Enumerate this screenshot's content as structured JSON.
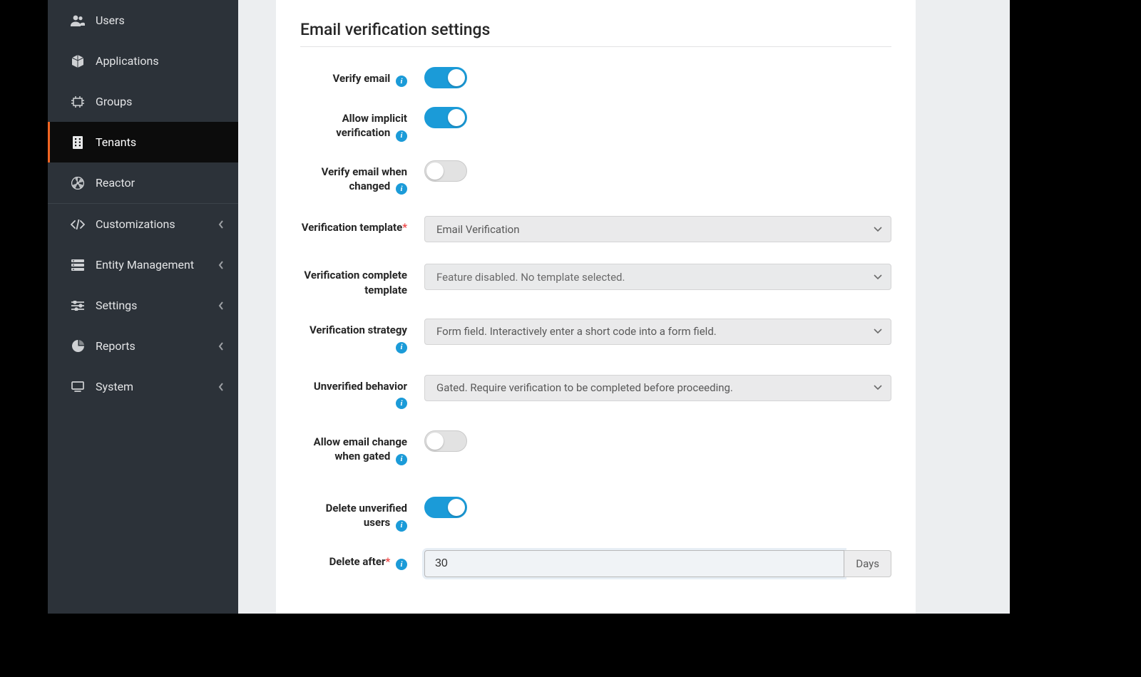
{
  "sidebar": {
    "items": [
      {
        "label": "Users"
      },
      {
        "label": "Applications"
      },
      {
        "label": "Groups"
      },
      {
        "label": "Tenants"
      },
      {
        "label": "Reactor"
      },
      {
        "label": "Customizations"
      },
      {
        "label": "Entity Management"
      },
      {
        "label": "Settings"
      },
      {
        "label": "Reports"
      },
      {
        "label": "System"
      }
    ],
    "active_index": 3
  },
  "section_title": "Email verification settings",
  "labels": {
    "verify_email": "Verify email",
    "allow_implicit": "Allow implicit verification",
    "verify_when_changed": "Verify email when changed",
    "verification_template": "Verification template",
    "verification_complete_template": "Verification complete template",
    "verification_strategy": "Verification strategy",
    "unverified_behavior": "Unverified behavior",
    "allow_email_change_gated": "Allow email change when gated",
    "delete_unverified_users": "Delete unverified users",
    "delete_after": "Delete after"
  },
  "values": {
    "verification_template": "Email Verification",
    "verification_complete_template": "Feature disabled. No template selected.",
    "verification_strategy": "Form field. Interactively enter a short code into a form field.",
    "unverified_behavior": "Gated. Require verification to be completed before proceeding.",
    "delete_after_value": "30",
    "delete_after_unit": "Days",
    "verify_email_on": true,
    "allow_implicit_on": true,
    "verify_when_changed_on": false,
    "allow_email_change_gated_on": false,
    "delete_unverified_users_on": true
  }
}
